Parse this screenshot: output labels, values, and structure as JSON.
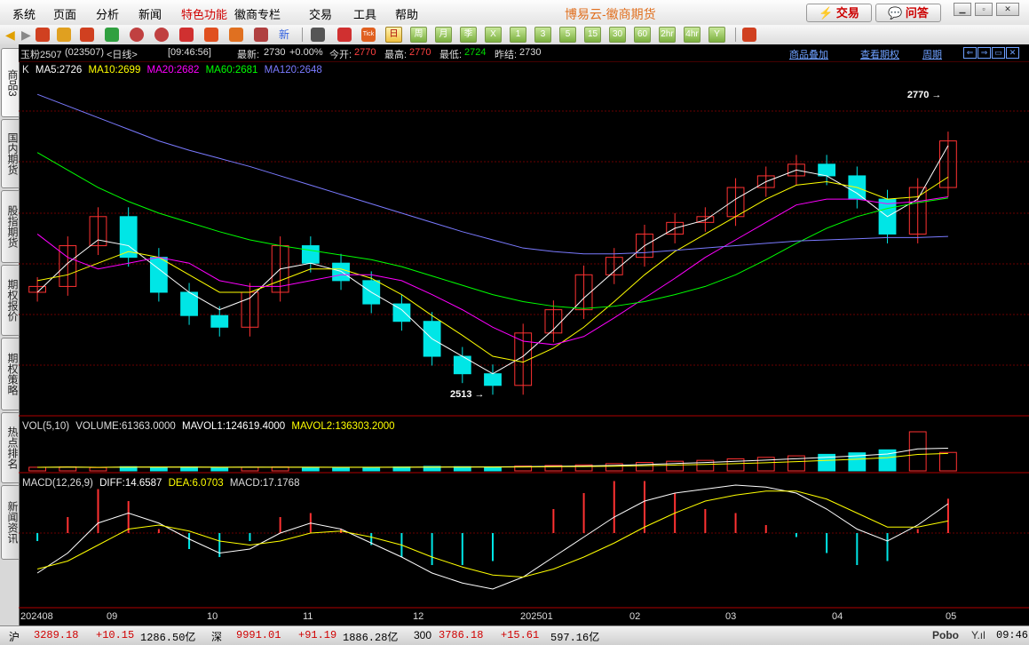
{
  "menu": {
    "items": [
      "系统",
      "页面",
      "分析",
      "新闻",
      "特色功能",
      "徽商专栏",
      "交易",
      "工具",
      "帮助"
    ],
    "highlight_index": 4,
    "app_title": "博易云-徽商期货",
    "trade_button": "交易",
    "qa_button": "问答"
  },
  "toolbar": {
    "period_buttons": [
      "日",
      "周",
      "月",
      "季",
      "X",
      "1",
      "3",
      "5",
      "15",
      "30",
      "60",
      "2hr",
      "4hr",
      "Y"
    ],
    "active_period": "日"
  },
  "side_tabs": [
    "商品3",
    "国内期货",
    "股指期货",
    "期权报价",
    "期权策略",
    "热点排名",
    "新闻资讯"
  ],
  "header": {
    "symbol": "玉粉2507",
    "code": "(023507)",
    "period": "<日线>",
    "time": "[09:46:56]",
    "latest_label": "最新:",
    "latest": "2730",
    "change": "+0.00%",
    "open_label": "今开:",
    "open": "2770",
    "high_label": "最高:",
    "high": "2770",
    "low_label": "最低:",
    "low": "2724",
    "prev_close_label": "昨结:",
    "prev_close": "2730",
    "links": [
      "商品叠加",
      "查看期权",
      "周期"
    ]
  },
  "ma_legend": {
    "k": "K",
    "ma5": "MA5:2726",
    "ma10": "MA10:2699",
    "ma20": "MA20:2682",
    "ma60": "MA60:2681",
    "ma120": "MA120:2648"
  },
  "vol_legend": {
    "name": "VOL(5,10)",
    "volume": "VOLUME:61363.0000",
    "mavol1": "MAVOL1:124619.4000",
    "mavol2": "MAVOL2:136303.2000"
  },
  "macd_legend": {
    "name": "MACD(12,26,9)",
    "diff": "DIFF:14.6587",
    "dea": "DEA:6.0703",
    "macd": "MACD:17.1768"
  },
  "annotations": {
    "max_label": "2770",
    "min_label": "2513"
  },
  "x_axis": [
    "202408",
    "09",
    "10",
    "11",
    "12",
    "202501",
    "02",
    "03",
    "04",
    "05"
  ],
  "statusbar": {
    "sh_label": "沪",
    "sh_index": "3289.18",
    "sh_change": "+10.15",
    "sh_amount": "1286.50亿",
    "sz_label": "深",
    "sz_index": "9991.01",
    "sz_change": "+91.19",
    "sz_amount": "1886.28亿",
    "c300_label": "300",
    "c300_index": "3786.18",
    "c300_change": "+15.61",
    "c300_amount": "597.16亿",
    "brand": "Pobo",
    "clock": "09:46"
  },
  "colors": {
    "up": "#ff3232",
    "down": "#00e6e6",
    "ma5": "#ffffff",
    "ma10": "#ffff00",
    "ma20": "#ff00ff",
    "ma60": "#00ff00",
    "ma120": "#7a7aff",
    "diff": "#ffffff",
    "dea": "#ffff00"
  },
  "chart_data": {
    "type": "line",
    "title": "玉粉2507 (023507)",
    "x": [
      "202408",
      "09",
      "10",
      "11",
      "12",
      "202501",
      "02",
      "03",
      "04",
      "05"
    ],
    "y_range": [
      2500,
      2790
    ],
    "series": [
      {
        "name": "close",
        "values": [
          2605,
          2640,
          2665,
          2630,
          2600,
          2580,
          2570,
          2600,
          2640,
          2625,
          2610,
          2590,
          2575,
          2545,
          2530,
          2520,
          2565,
          2585,
          2615,
          2630,
          2650,
          2660,
          2665,
          2690,
          2700,
          2710,
          2700,
          2680,
          2650,
          2690,
          2730
        ]
      },
      {
        "name": "MA5",
        "values": [
          2600,
          2625,
          2645,
          2640,
          2620,
          2600,
          2585,
          2595,
          2620,
          2625,
          2618,
          2600,
          2585,
          2560,
          2545,
          2530,
          2545,
          2568,
          2595,
          2618,
          2640,
          2655,
          2662,
          2680,
          2695,
          2705,
          2700,
          2685,
          2665,
          2680,
          2726
        ]
      },
      {
        "name": "MA10",
        "values": [
          2610,
          2615,
          2625,
          2635,
          2630,
          2615,
          2600,
          2600,
          2610,
          2620,
          2620,
          2612,
          2598,
          2580,
          2563,
          2545,
          2540,
          2552,
          2570,
          2592,
          2615,
          2635,
          2650,
          2665,
          2680,
          2692,
          2695,
          2690,
          2680,
          2682,
          2699
        ]
      },
      {
        "name": "MA20",
        "values": [
          2650,
          2630,
          2620,
          2625,
          2630,
          2625,
          2610,
          2605,
          2605,
          2610,
          2615,
          2615,
          2610,
          2598,
          2585,
          2570,
          2558,
          2555,
          2562,
          2578,
          2595,
          2612,
          2630,
          2645,
          2660,
          2675,
          2680,
          2680,
          2676,
          2678,
          2682
        ]
      },
      {
        "name": "MA60",
        "values": [
          2720,
          2705,
          2690,
          2678,
          2668,
          2660,
          2652,
          2645,
          2640,
          2636,
          2632,
          2628,
          2622,
          2614,
          2606,
          2598,
          2592,
          2588,
          2586,
          2588,
          2592,
          2598,
          2605,
          2615,
          2628,
          2642,
          2655,
          2665,
          2672,
          2677,
          2681
        ]
      },
      {
        "name": "MA120",
        "values": [
          2770,
          2760,
          2750,
          2740,
          2730,
          2722,
          2715,
          2708,
          2700,
          2692,
          2684,
          2676,
          2668,
          2660,
          2652,
          2645,
          2638,
          2635,
          2633,
          2633,
          2634,
          2636,
          2638,
          2640,
          2642,
          2644,
          2645,
          2646,
          2647,
          2647,
          2648
        ]
      },
      {
        "name": "VOLUME",
        "values": [
          12000,
          13000,
          11000,
          14000,
          12000,
          13000,
          11000,
          12000,
          13000,
          12000,
          11000,
          12000,
          13000,
          15000,
          14000,
          13000,
          16000,
          18000,
          20000,
          24000,
          28000,
          32000,
          35000,
          40000,
          45000,
          50000,
          55000,
          60000,
          70000,
          130000,
          61363
        ]
      },
      {
        "name": "DIFF",
        "values": [
          -20,
          -10,
          5,
          10,
          5,
          -3,
          -10,
          -8,
          0,
          5,
          2,
          -5,
          -12,
          -20,
          -25,
          -28,
          -22,
          -12,
          -2,
          8,
          16,
          20,
          22,
          24,
          23,
          20,
          12,
          2,
          -4,
          4,
          14.66
        ]
      },
      {
        "name": "DEA",
        "values": [
          -18,
          -14,
          -6,
          2,
          4,
          1,
          -4,
          -6,
          -4,
          0,
          1,
          -2,
          -6,
          -12,
          -17,
          -21,
          -22,
          -18,
          -12,
          -5,
          3,
          10,
          16,
          19,
          21,
          21,
          17,
          10,
          3,
          3,
          6.07
        ]
      },
      {
        "name": "MACD",
        "values": [
          -4,
          8,
          22,
          16,
          2,
          -8,
          -12,
          -4,
          8,
          10,
          2,
          -6,
          -12,
          -16,
          -16,
          -14,
          0,
          12,
          20,
          26,
          26,
          20,
          12,
          10,
          4,
          -2,
          -10,
          -16,
          -14,
          2,
          17.18
        ]
      }
    ]
  }
}
